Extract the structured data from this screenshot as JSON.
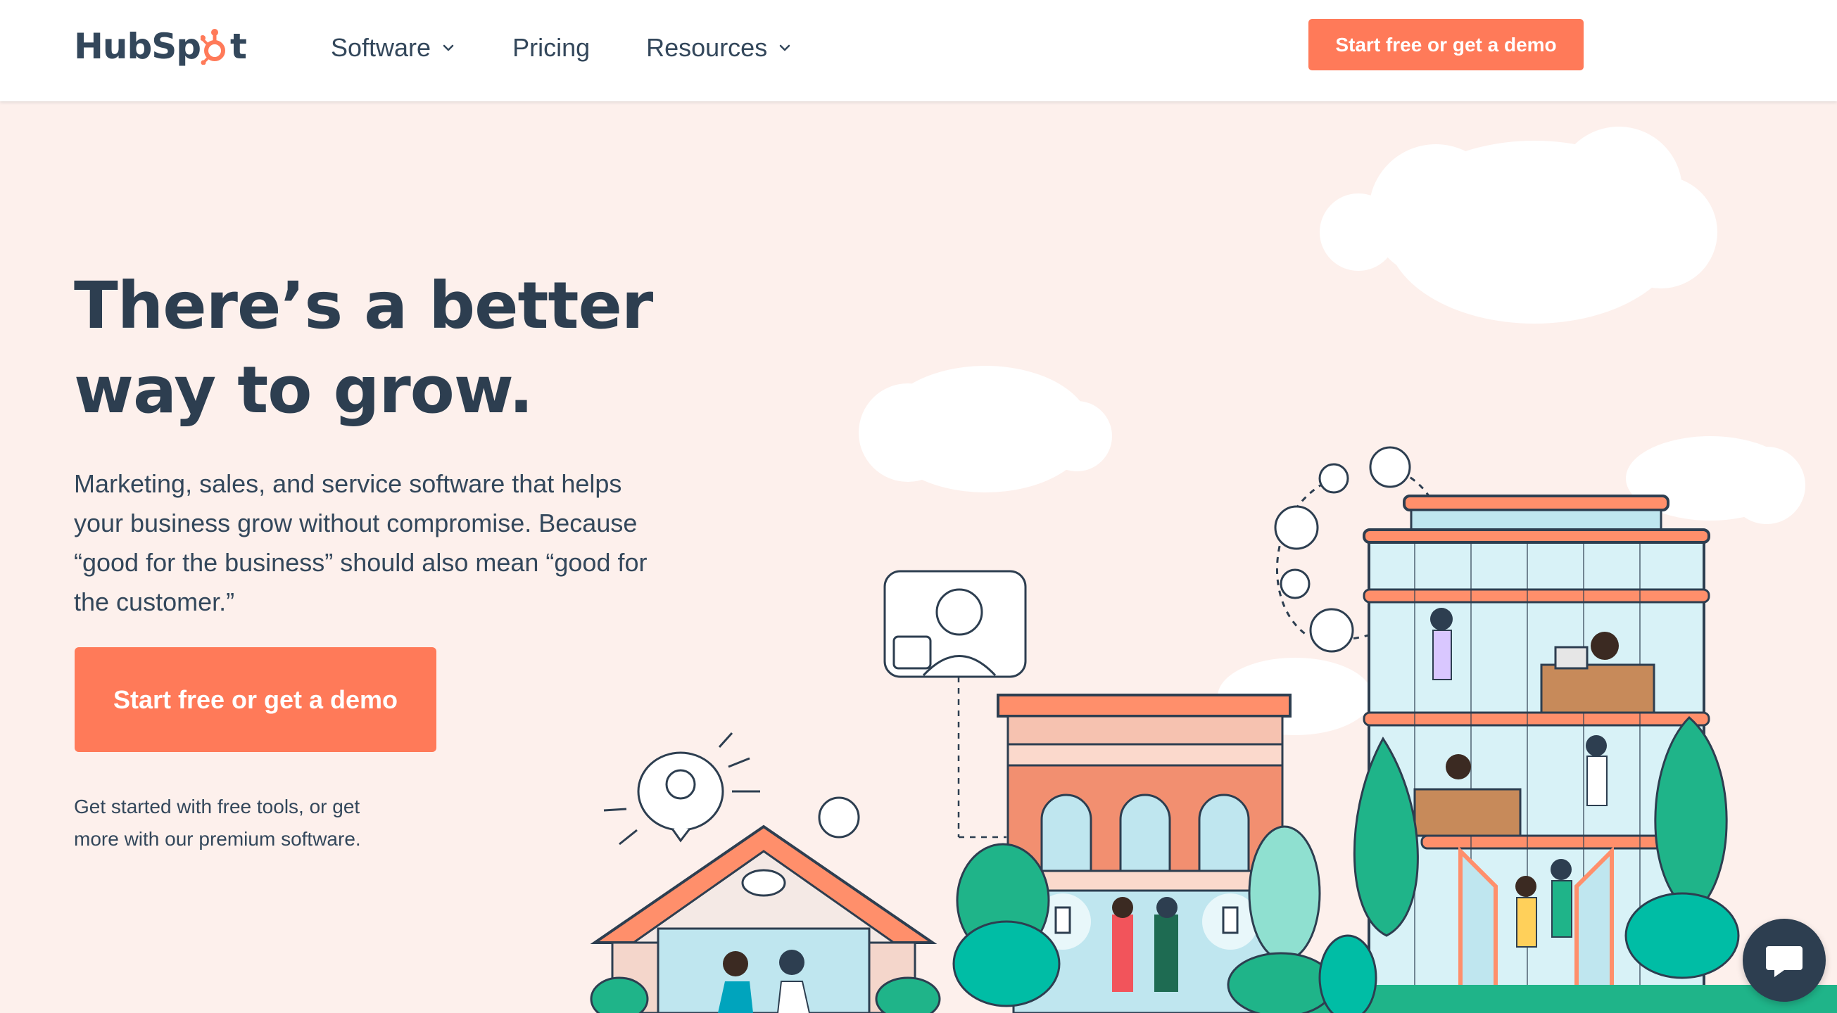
{
  "brand": {
    "name": "HubSpot",
    "logo_text_left": "HubSp",
    "logo_text_right": "t",
    "accent": "#ff7a59",
    "ink": "#2d3e50"
  },
  "nav": {
    "items": [
      {
        "label": "Software",
        "has_dropdown": true
      },
      {
        "label": "Pricing",
        "has_dropdown": false
      },
      {
        "label": "Resources",
        "has_dropdown": true
      }
    ],
    "cta_label": "Start free or get a demo"
  },
  "hero": {
    "title_line1": "There’s a better",
    "title_line2": "way to grow.",
    "subtitle_line1": "Marketing, sales, and service software that helps",
    "subtitle_line2": "your business grow without compromise. Because",
    "subtitle_line3": "“good for the business” should also mean “good for",
    "subtitle_line4": "the customer.”",
    "cta_label": "Start free or get a demo",
    "note_line1": "Get started with free tools, or get",
    "note_line2": "more with our premium software."
  },
  "icons": {
    "chevron": "chevron-down-icon",
    "chat": "chat-bubble-icon",
    "sprocket": "hubspot-sprocket-icon"
  },
  "colors": {
    "page_bg": "#fdf0ec",
    "cloud": "#ffffff",
    "teal": "#00a4bd",
    "green": "#1fb489",
    "brick": "#f2a48c",
    "orange": "#ff7a59",
    "chat_bg": "#2d3e50"
  }
}
